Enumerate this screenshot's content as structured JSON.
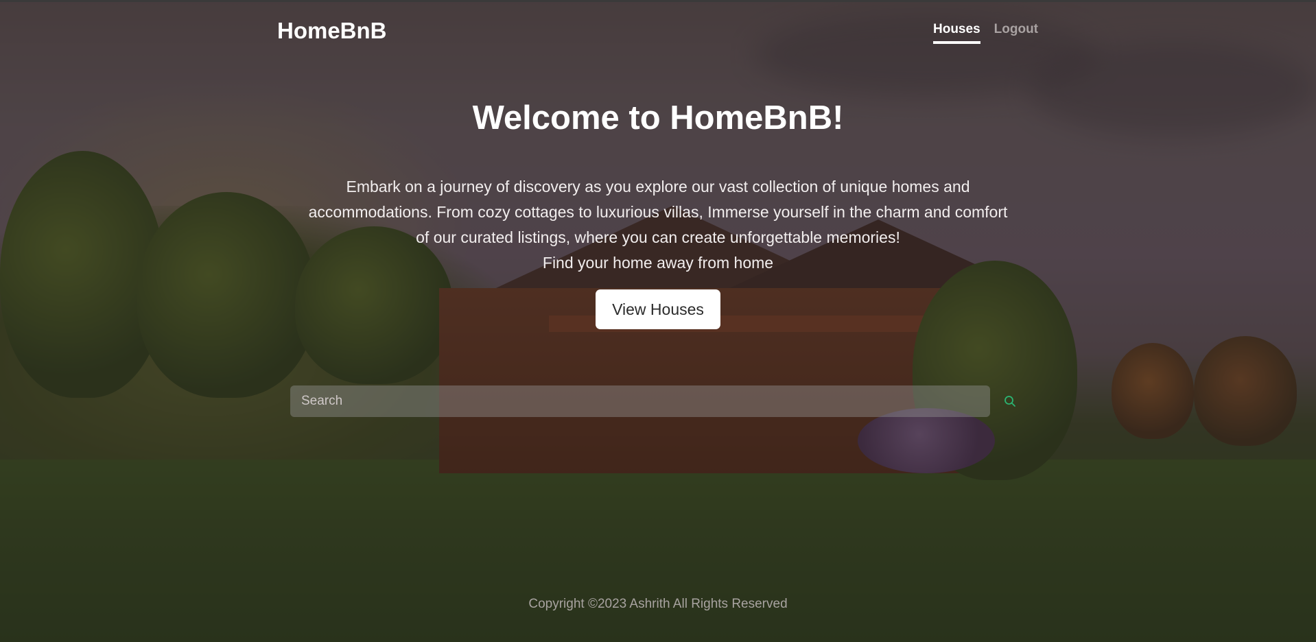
{
  "navbar": {
    "brand": "HomeBnB",
    "links": [
      {
        "label": "Houses",
        "active": true
      },
      {
        "label": "Logout",
        "active": false
      }
    ]
  },
  "hero": {
    "title": "Welcome to HomeBnB!",
    "description_lines": [
      "Embark on a journey of discovery as you explore our vast collection of unique homes and",
      "accommodations. From cozy cottages to luxurious villas, Immerse yourself in the charm and comfort",
      "of our curated listings, where you can create unforgettable memories!",
      "Find your home away from home"
    ],
    "cta_label": "View Houses"
  },
  "search": {
    "placeholder": "Search",
    "value": "",
    "button_icon": "search-icon"
  },
  "footer": {
    "copyright": "Copyright ©2023 Ashrith All Rights Reserved"
  },
  "colors": {
    "overlay": "#231c1e",
    "search_icon": "#2bb673",
    "cta_background": "#ffffff"
  }
}
